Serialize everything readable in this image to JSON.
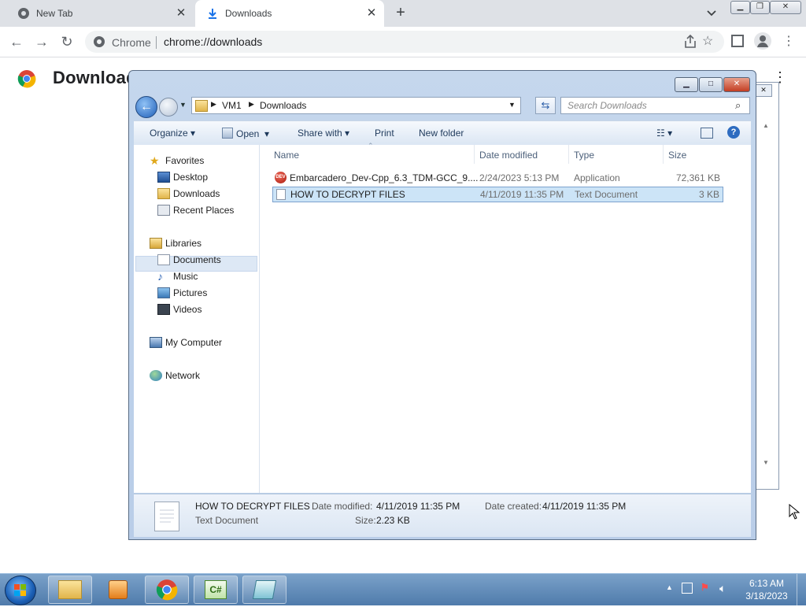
{
  "browser": {
    "tabs": [
      {
        "title": "New Tab",
        "active": false
      },
      {
        "title": "Downloads",
        "active": true
      }
    ],
    "new_tab": "+",
    "omnibox": {
      "site_label": "Chrome",
      "url": "chrome://downloads"
    },
    "page_title": "Download"
  },
  "explorer": {
    "breadcrumb": [
      "VM1",
      "Downloads"
    ],
    "search_placeholder": "Search Downloads",
    "commands": {
      "organize": "Organize",
      "open": "Open",
      "share": "Share with",
      "print": "Print",
      "new_folder": "New folder"
    },
    "nav": {
      "favorites": "Favorites",
      "desktop": "Desktop",
      "downloads": "Downloads",
      "recent": "Recent Places",
      "libraries": "Libraries",
      "documents": "Documents",
      "music": "Music",
      "pictures": "Pictures",
      "videos": "Videos",
      "computer": "My Computer",
      "network": "Network"
    },
    "columns": {
      "name": "Name",
      "date": "Date modified",
      "type": "Type",
      "size": "Size"
    },
    "files": [
      {
        "name": "Embarcadero_Dev-Cpp_6.3_TDM-GCC_9....",
        "date": "2/24/2023 5:13 PM",
        "type": "Application",
        "size": "72,361 KB",
        "selected": false
      },
      {
        "name": "HOW TO DECRYPT FILES",
        "date": "4/11/2019 11:35 PM",
        "type": "Text Document",
        "size": "3 KB",
        "selected": true
      }
    ],
    "details": {
      "name": "HOW TO DECRYPT FILES",
      "kind": "Text Document",
      "modified_label": "Date modified:",
      "modified": "4/11/2019 11:35 PM",
      "created_label": "Date created:",
      "created": "4/11/2019 11:35 PM",
      "size_label": "Size:",
      "size": "2.23 KB"
    }
  },
  "taskbar": {
    "time": "6:13 AM",
    "date": "3/18/2023"
  },
  "colors": {
    "chrome_tabstrip": "#dee1e6",
    "explorer_frame": "#c5d7ed",
    "selection": "#cce4f7",
    "taskbar": "#5a86b5"
  }
}
